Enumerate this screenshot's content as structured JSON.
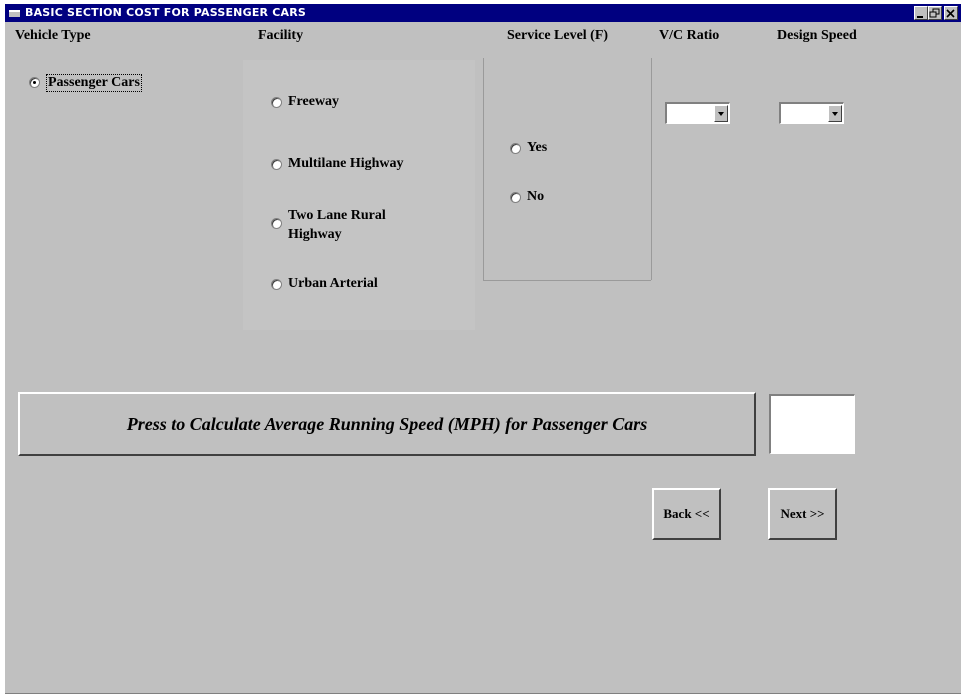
{
  "window": {
    "title": "BASIC SECTION COST FOR PASSENGER CARS"
  },
  "headers": {
    "vehicle_type": "Vehicle Type",
    "facility": "Facility",
    "service_level": "Service Level (F)",
    "vc_ratio": "V/C Ratio",
    "design_speed": "Design Speed"
  },
  "vehicle": {
    "option": "Passenger Cars",
    "selected": true
  },
  "facility": {
    "freeway": "Freeway",
    "multilane": "Multilane Highway",
    "two_lane_1": "Two Lane Rural",
    "two_lane_2": "Highway",
    "urban": "Urban Arterial"
  },
  "service_level": {
    "yes": "Yes",
    "no": "No"
  },
  "vc_ratio": {
    "value": ""
  },
  "design_speed": {
    "value": ""
  },
  "calculate_button": "Press to Calculate Average Running Speed (MPH) for Passenger Cars",
  "result": {
    "value": ""
  },
  "nav": {
    "back": "Back <<",
    "next": "Next >>"
  }
}
